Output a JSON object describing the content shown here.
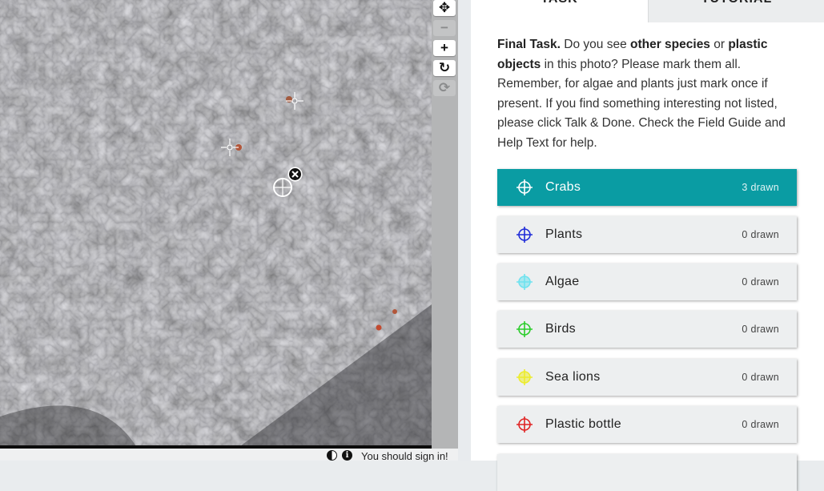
{
  "viewer": {
    "image": "aerial-rocky-shore-photo",
    "footer": {
      "signin_message": "You should sign in!",
      "contrast_icon": "contrast-icon",
      "info_icon": "info-icon",
      "info_glyph": "i"
    }
  },
  "toolbar": [
    {
      "name": "move-icon",
      "glyph": "✥",
      "disabled": false
    },
    {
      "name": "zoom-out-icon",
      "glyph": "−",
      "disabled": true
    },
    {
      "name": "zoom-in-icon",
      "glyph": "+",
      "disabled": false
    },
    {
      "name": "rotate-icon",
      "glyph": "↻",
      "disabled": false
    },
    {
      "name": "reset-icon",
      "glyph": "⟳",
      "disabled": true
    }
  ],
  "tabs": {
    "task": "TASK",
    "tutorial": "TUTORIAL"
  },
  "instructions": {
    "lead": "Final Task.",
    "part1": " Do you see ",
    "bold1": "other species",
    "part2": " or ",
    "bold2": "plastic objects",
    "part3": " in this photo? Please mark them all. Remember, for algae and plants just mark once if present. If you find something interesting not listed, please click Talk & Done. Check the Field Guide and Help Text for help."
  },
  "tools": [
    {
      "label": "Crabs",
      "count": "3 drawn",
      "color": "#ffffff",
      "active": true
    },
    {
      "label": "Plants",
      "count": "0 drawn",
      "color": "#1f2bd8",
      "active": false
    },
    {
      "label": "Algae",
      "count": "0 drawn",
      "color": "#6fe2ef",
      "active": false
    },
    {
      "label": "Birds",
      "count": "0 drawn",
      "color": "#2bcd2b",
      "active": false
    },
    {
      "label": "Sea lions",
      "count": "0 drawn",
      "color": "#ecec2c",
      "active": false
    },
    {
      "label": "Plastic bottle",
      "count": "0 drawn",
      "color": "#e02424",
      "active": false
    },
    {
      "label": "",
      "count": "",
      "color": "#888888",
      "active": false
    }
  ],
  "colors": {
    "accent": "#0a9ca3",
    "tool_bg": "#edeff0"
  }
}
